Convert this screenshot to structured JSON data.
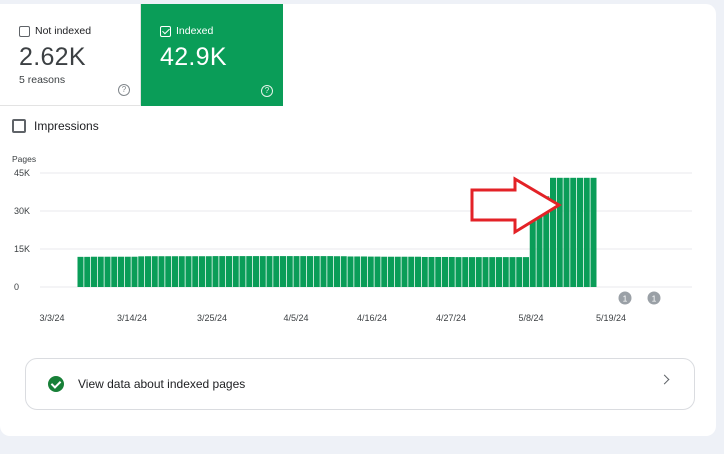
{
  "tiles": {
    "not_indexed": {
      "label": "Not indexed",
      "value": "2.62K",
      "sub": "5 reasons",
      "help": "?"
    },
    "indexed": {
      "label": "Indexed",
      "value": "42.9K",
      "help": "?"
    }
  },
  "impressions_label": "Impressions",
  "view_link_label": "View data about indexed pages",
  "colors": {
    "indexed_green": "#0a9d58",
    "annotation_arrow": "#e32227"
  },
  "chart_data": {
    "type": "bar",
    "ylabel": "Pages",
    "ylim": [
      0,
      45000
    ],
    "yticks": [
      0,
      15000,
      30000,
      45000
    ],
    "ytick_labels": [
      "0",
      "15K",
      "30K",
      "45K"
    ],
    "xtick_labels": [
      "3/3/24",
      "3/14/24",
      "3/25/24",
      "4/5/24",
      "4/16/24",
      "4/27/24",
      "5/8/24",
      "5/19/24"
    ],
    "gridlines": true,
    "annotation_markers": [
      "1",
      "1"
    ],
    "values": [
      11900,
      11900,
      11950,
      11950,
      11950,
      11950,
      11950,
      11950,
      11950,
      12100,
      12150,
      12150,
      12150,
      12150,
      12150,
      12150,
      12150,
      12150,
      12150,
      12150,
      12200,
      12200,
      12200,
      12200,
      12200,
      12200,
      12200,
      12200,
      12200,
      12200,
      12200,
      12200,
      12200,
      12200,
      12200,
      12200,
      12200,
      12200,
      12150,
      12150,
      12050,
      12050,
      12050,
      12000,
      12000,
      11950,
      11950,
      11950,
      11950,
      11950,
      11950,
      11850,
      11850,
      11850,
      11850,
      11850,
      11800,
      11800,
      11800,
      11800,
      11800,
      11800,
      11800,
      11800,
      11800,
      11800,
      11800,
      35800,
      35800,
      35800,
      43100,
      43100,
      43100,
      43100,
      43100,
      43100,
      43100
    ]
  }
}
